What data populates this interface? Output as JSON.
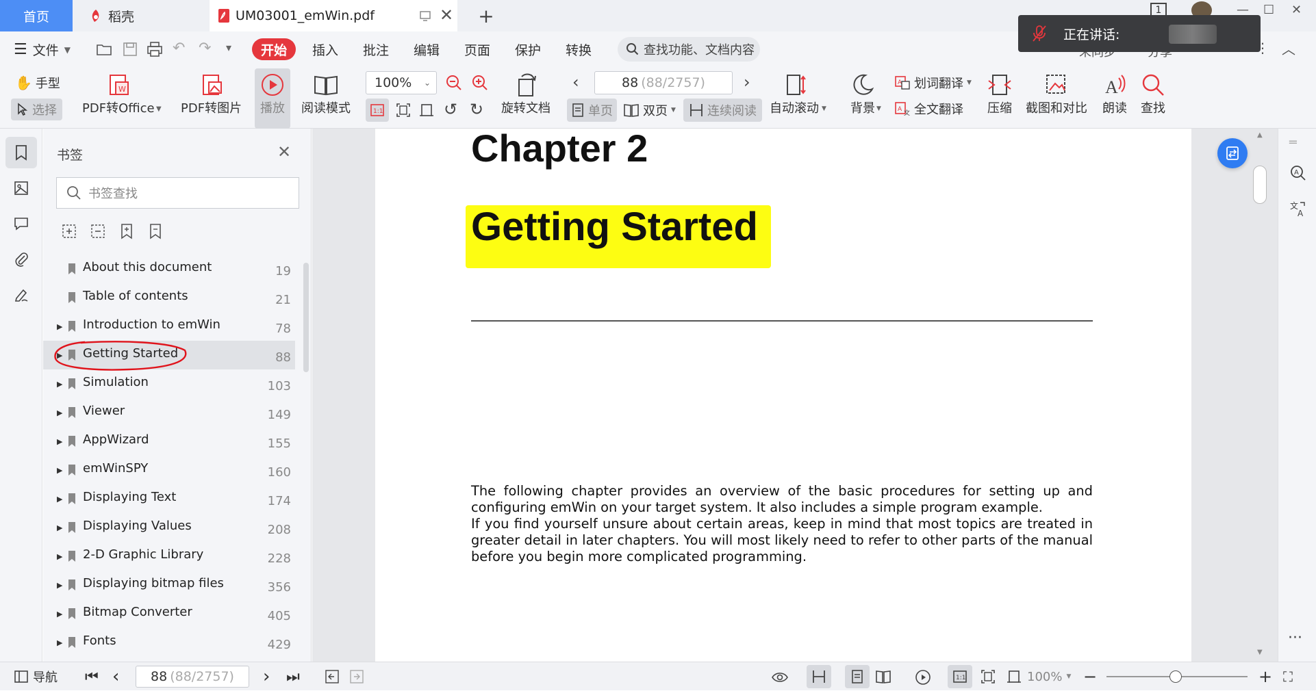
{
  "tabs": {
    "home": "首页",
    "daoke": "稻壳",
    "pdf": "UM03001_emWin.pdf"
  },
  "menu": {
    "file": "文件",
    "start": "开始",
    "insert": "插入",
    "annotate": "批注",
    "edit": "编辑",
    "page": "页面",
    "protect": "保护",
    "convert": "转换",
    "search_placeholder": "查找功能、文档内容",
    "partial_right": [
      "未同步",
      "分享"
    ]
  },
  "ribbon": {
    "hand": "手型",
    "select": "选择",
    "pdf_to_office": "PDF转Office",
    "pdf_to_image": "PDF转图片",
    "play": "播放",
    "read_mode": "阅读模式",
    "zoom": "100%",
    "rotate_doc": "旋转文档",
    "page_current": "88",
    "page_total": "(88/2757)",
    "single": "单页",
    "double": "双页",
    "continuous": "连续阅读",
    "auto_scroll": "自动滚动",
    "background": "背景",
    "word_translate": "划词翻译",
    "full_translate": "全文翻译",
    "compress": "压缩",
    "screenshot_compare": "截图和对比",
    "read_aloud": "朗读",
    "find": "查找"
  },
  "bookmark_panel": {
    "title": "书签",
    "search_placeholder": "书签查找",
    "items": [
      {
        "label": "About this document",
        "page": "19",
        "expandable": false
      },
      {
        "label": "Table of contents",
        "page": "21",
        "expandable": false
      },
      {
        "label": "Introduction to emWin",
        "page": "78",
        "expandable": true
      },
      {
        "label": "Getting Started",
        "page": "88",
        "expandable": true
      },
      {
        "label": "Simulation",
        "page": "103",
        "expandable": true
      },
      {
        "label": "Viewer",
        "page": "149",
        "expandable": true
      },
      {
        "label": "AppWizard",
        "page": "155",
        "expandable": true
      },
      {
        "label": "emWinSPY",
        "page": "160",
        "expandable": true
      },
      {
        "label": "Displaying Text",
        "page": "174",
        "expandable": true
      },
      {
        "label": "Displaying Values",
        "page": "208",
        "expandable": true
      },
      {
        "label": "2-D Graphic Library",
        "page": "228",
        "expandable": true
      },
      {
        "label": "Displaying bitmap files",
        "page": "356",
        "expandable": true
      },
      {
        "label": "Bitmap Converter",
        "page": "405",
        "expandable": true
      },
      {
        "label": "Fonts",
        "page": "429",
        "expandable": true
      }
    ]
  },
  "document": {
    "chapter": "Chapter 2",
    "heading": "Getting Started",
    "para1": "The following chapter provides an overview of the basic procedures for setting up and configuring emWin on your target system. It also includes a simple program example.",
    "para2": "If you find yourself unsure about certain areas, keep in mind that most topics are treated in greater detail in later chapters. You will most likely need to refer to other parts of the manual before you begin more complicated programming."
  },
  "statusbar": {
    "nav": "导航",
    "page_current": "88",
    "page_total": "(88/2757)",
    "zoom": "100%"
  },
  "popup": {
    "speaking": "正在讲话:"
  },
  "window": {
    "badge": "1"
  },
  "colors": {
    "home_tab": "#4d8ef5",
    "start_button": "#e5373d",
    "highlight": "#fdfd12",
    "annotation": "#e0141c",
    "fab": "#2f7cf2"
  }
}
